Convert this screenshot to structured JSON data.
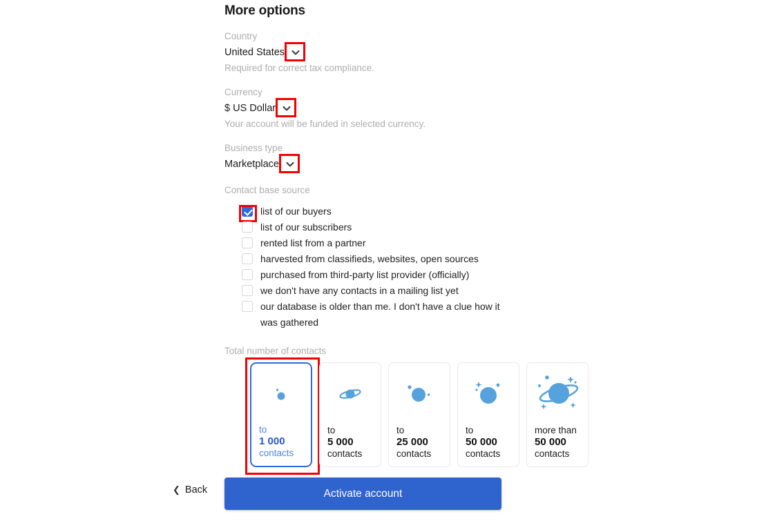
{
  "page": {
    "title": "More options"
  },
  "country": {
    "label": "Country",
    "value": "United States",
    "hint": "Required for correct tax compliance.",
    "chevron_icon": "chevron-down-icon"
  },
  "currency": {
    "label": "Currency",
    "value": "$ US Dollar",
    "hint": "Your account will be funded in selected currency.",
    "chevron_icon": "chevron-down-icon"
  },
  "business_type": {
    "label": "Business type",
    "value": "Marketplace",
    "chevron_icon": "chevron-down-icon"
  },
  "contact_base_source": {
    "label": "Contact base source",
    "options": [
      {
        "label": "list of our buyers",
        "checked": true
      },
      {
        "label": "list of our subscribers",
        "checked": false
      },
      {
        "label": "rented list from a partner",
        "checked": false
      },
      {
        "label": "harvested from classifieds, websites, open sources",
        "checked": false
      },
      {
        "label": "purchased from third-party list provider (officially)",
        "checked": false
      },
      {
        "label": "we don't have any contacts in a mailing list yet",
        "checked": false
      },
      {
        "label": "our database is older than me. I don't have a clue how it was gathered",
        "checked": false
      }
    ]
  },
  "total_contacts": {
    "label": "Total number of contacts",
    "cards": [
      {
        "prefix": "to",
        "number": "1 000",
        "suffix": "contacts",
        "icon": "tiny-planet-icon",
        "selected": true
      },
      {
        "prefix": "to",
        "number": "5 000",
        "suffix": "contacts",
        "icon": "small-saturn-icon",
        "selected": false
      },
      {
        "prefix": "to",
        "number": "25 000",
        "suffix": "contacts",
        "icon": "planet-with-moons-icon",
        "selected": false
      },
      {
        "prefix": "to",
        "number": "50 000",
        "suffix": "contacts",
        "icon": "planet-with-sparkles-icon",
        "selected": false
      },
      {
        "prefix": "more than",
        "number": "50 000",
        "suffix": "contacts",
        "icon": "large-saturn-icon",
        "selected": false
      }
    ]
  },
  "footer": {
    "back_label": "Back",
    "back_chevron_icon": "chevron-left-icon",
    "activate_label": "Activate account"
  },
  "colors": {
    "accent_blue": "#2f63ce",
    "selected_border": "#2f6ad9",
    "icon_blue": "#55a2dd",
    "highlight_red": "#f50000",
    "muted_label": "#adadad"
  }
}
